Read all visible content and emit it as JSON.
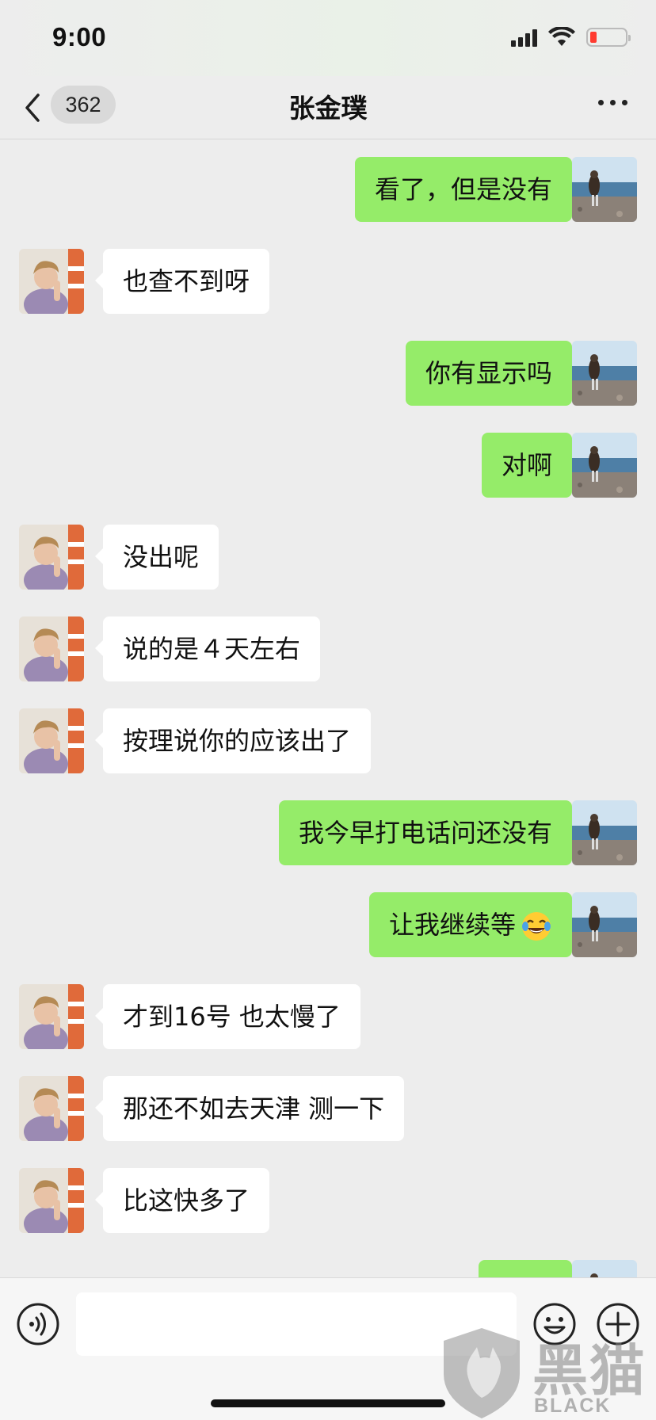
{
  "status_bar": {
    "time": "9:00"
  },
  "header": {
    "unread_count": "362",
    "title": "张金璞"
  },
  "messages": [
    {
      "side": "right",
      "text": "看了，但是没有"
    },
    {
      "side": "left",
      "text": "也查不到呀"
    },
    {
      "side": "right",
      "text": "你有显示吗"
    },
    {
      "side": "right",
      "text": "对啊"
    },
    {
      "side": "left",
      "text": "没出呢"
    },
    {
      "side": "left",
      "text": "说的是４天左右"
    },
    {
      "side": "left",
      "text": "按理说你的应该出了"
    },
    {
      "side": "right",
      "text": "我今早打电话问还没有"
    },
    {
      "side": "right",
      "text": "让我继续等",
      "emoji": "face-with-tears-of-joy"
    },
    {
      "side": "left",
      "text": "才到16号 也太慢了"
    },
    {
      "side": "left",
      "text": "那还不如去天津 测一下"
    },
    {
      "side": "left",
      "text": "比这快多了"
    },
    {
      "side": "right",
      "text": ""
    }
  ],
  "input_bar": {
    "placeholder": ""
  },
  "watermark": {
    "cn": "黑猫",
    "en": "BLACK CAT"
  }
}
